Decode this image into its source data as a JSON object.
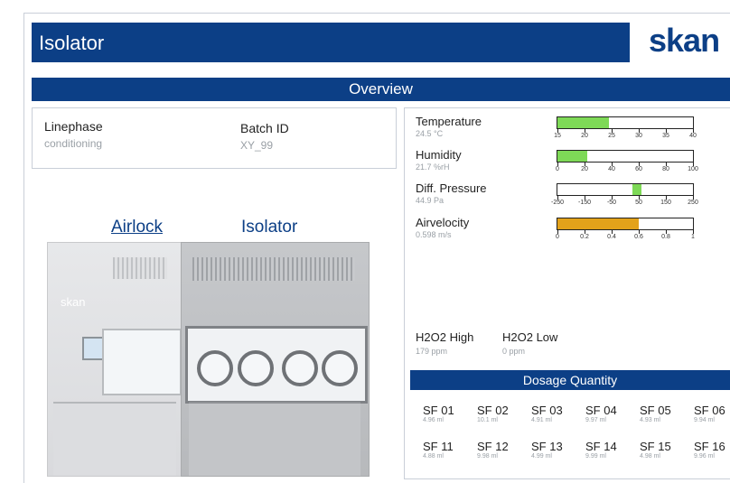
{
  "header": {
    "title": "Isolator",
    "brand": "skan"
  },
  "overview": {
    "title": "Overview"
  },
  "status": {
    "linephase_label": "Linephase",
    "linephase_value": "conditioning",
    "batch_label": "Batch ID",
    "batch_value": "XY_99"
  },
  "zones": {
    "airlock": "Airlock",
    "isolator": "Isolator",
    "machine_brand": "skan"
  },
  "meters": [
    {
      "label": "Temperature",
      "value": "24.5 °C",
      "fill": 0.38,
      "color": "#7ed957",
      "ticks": [
        "15",
        "20",
        "25",
        "30",
        "35",
        "40"
      ]
    },
    {
      "label": "Humidity",
      "value": "21.7 %rH",
      "fill": 0.217,
      "color": "#7ed957",
      "ticks": [
        "0",
        "20",
        "40",
        "60",
        "80",
        "100"
      ]
    },
    {
      "label": "Diff. Pressure",
      "value": "44.9 Pa",
      "marker": 0.589,
      "color": "#7ed957",
      "ticks": [
        "-250",
        "-150",
        "-50",
        "50",
        "150",
        "250"
      ]
    },
    {
      "label": "Airvelocity",
      "value": "0.598 m/s",
      "fill": 0.598,
      "color": "#e3a21a",
      "ticks": [
        "0",
        "0.2",
        "0.4",
        "0.6",
        "0.8",
        "1"
      ]
    }
  ],
  "h2o2": {
    "high_label": "H2O2 High",
    "high_value": "179 ppm",
    "low_label": "H2O2 Low",
    "low_value": "0 ppm"
  },
  "dosage": {
    "title": "Dosage Quantity",
    "row1": [
      {
        "name": "SF 01",
        "value": "4.96 ml"
      },
      {
        "name": "SF 02",
        "value": "10.1 ml"
      },
      {
        "name": "SF 03",
        "value": "4.91 ml"
      },
      {
        "name": "SF 04",
        "value": "9.97 ml"
      },
      {
        "name": "SF 05",
        "value": "4.93 ml"
      },
      {
        "name": "SF 06",
        "value": "9.94 ml"
      }
    ],
    "row2": [
      {
        "name": "SF 11",
        "value": "4.88 ml"
      },
      {
        "name": "SF 12",
        "value": "9.98 ml"
      },
      {
        "name": "SF 13",
        "value": "4.99 ml"
      },
      {
        "name": "SF 14",
        "value": "9.99 ml"
      },
      {
        "name": "SF 15",
        "value": "4.98 ml"
      },
      {
        "name": "SF 16",
        "value": "9.96 ml"
      }
    ]
  }
}
